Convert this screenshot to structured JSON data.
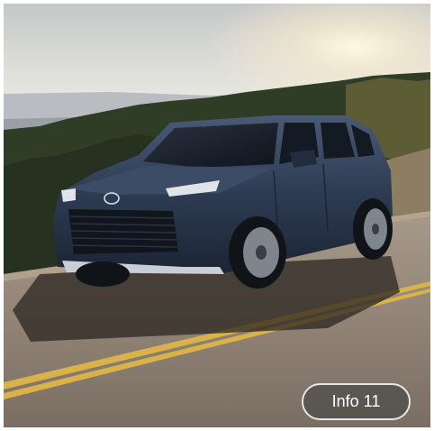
{
  "photo": {
    "subject": "suv-driving-on-mountain-road",
    "badge_label": "Info 11"
  },
  "colors": {
    "vehicle_body": "#2d3b52",
    "sky": "#d8dce0",
    "sun_glow": "#fff4d6",
    "forest": "#2c3a24",
    "road": "#8c7f72",
    "road_center_line": "#d9b24a",
    "pill_background": "#56534e",
    "pill_border": "#e6e6e6"
  }
}
